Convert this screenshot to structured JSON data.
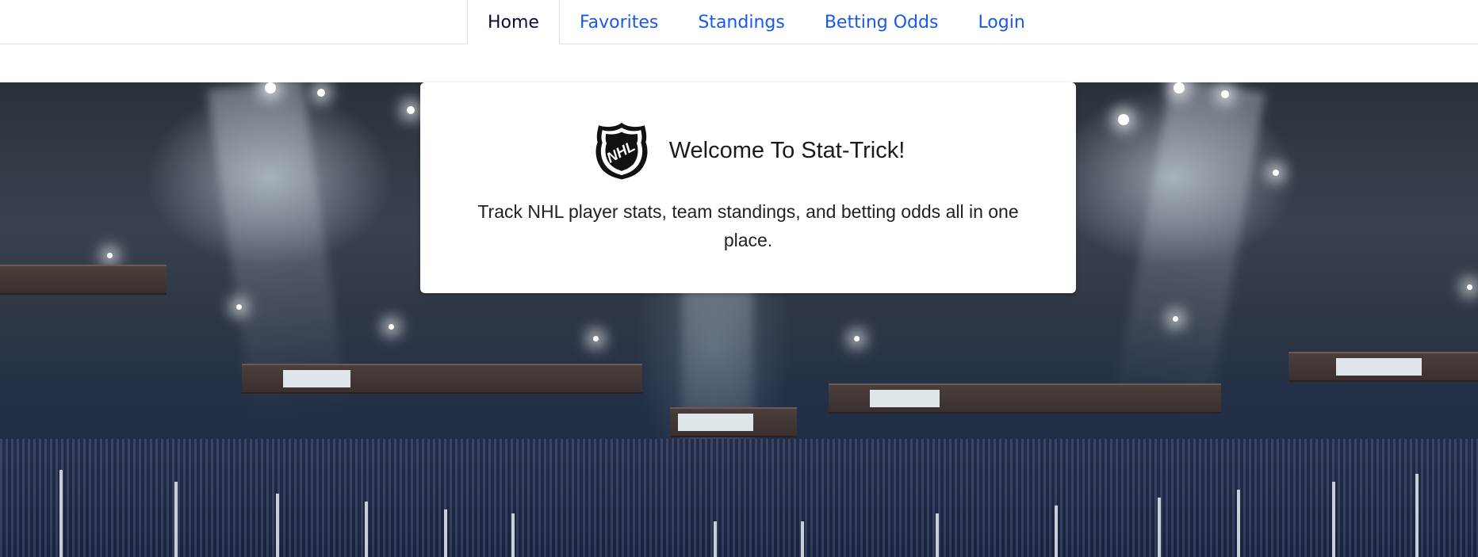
{
  "nav": {
    "tabs": [
      {
        "label": "Home",
        "active": true
      },
      {
        "label": "Favorites",
        "active": false
      },
      {
        "label": "Standings",
        "active": false
      },
      {
        "label": "Betting Odds",
        "active": false
      },
      {
        "label": "Login",
        "active": false
      }
    ]
  },
  "hero": {
    "background": "arena-background-image"
  },
  "card": {
    "logo": "nhl-shield-icon",
    "title": "Welcome To Stat-Trick!",
    "description": "Track NHL player stats, team standings, and betting odds all in one place."
  },
  "colors": {
    "link": "#1a56f0",
    "active_tab": "#0a0a40",
    "card_background": "#ffffff"
  }
}
